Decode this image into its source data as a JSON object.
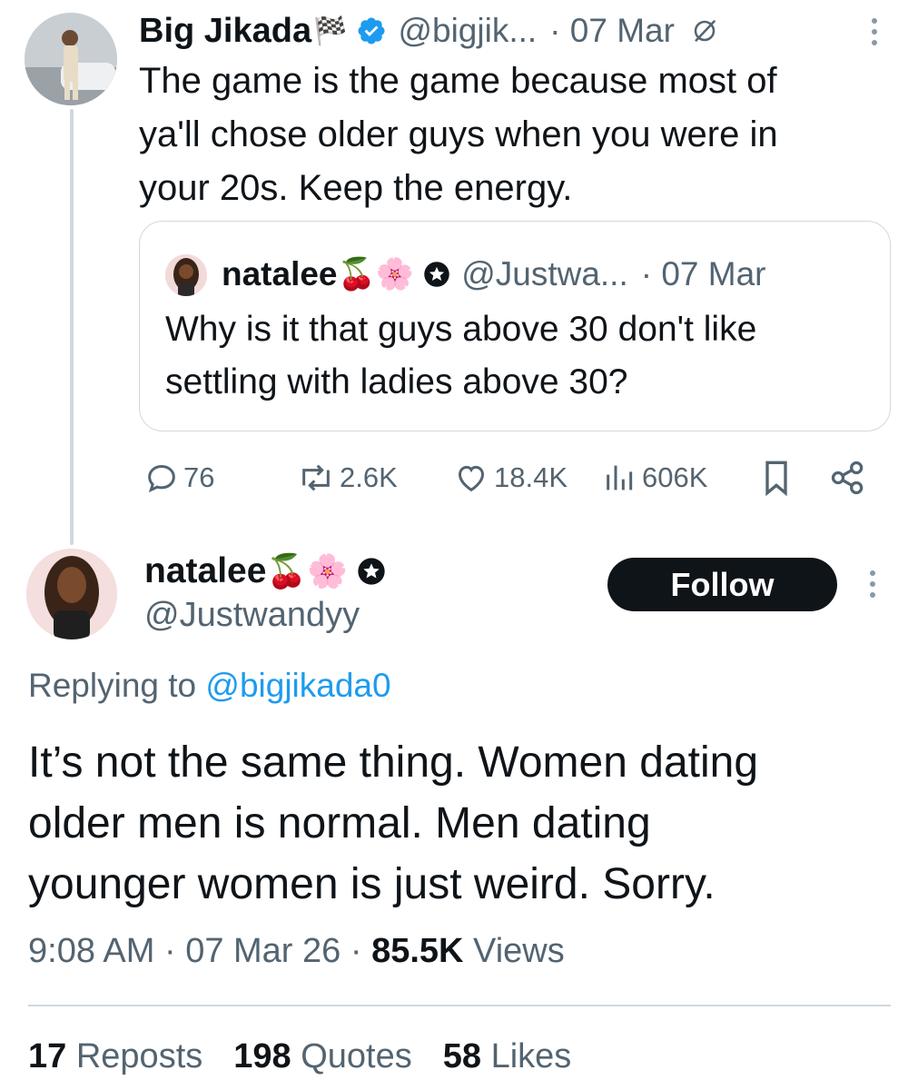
{
  "tweet1": {
    "author_name": "Big Jikada",
    "flag_emoji": "🏁",
    "handle": "@bigjik...",
    "date": "· 07 Mar",
    "text_lines": [
      "The game is the game because most of",
      "ya'll chose older guys when you were in",
      "your 20s. Keep the energy."
    ]
  },
  "quote": {
    "author_name": "natalee",
    "emojis": "🍒🌸",
    "handle": "@Justwa...",
    "date": "· 07 Mar",
    "text_lines": [
      "Why is it that guys above 30 don't like",
      "settling with ladies above 30?"
    ]
  },
  "actions": {
    "replies": "76",
    "reposts": "2.6K",
    "likes": "18.4K",
    "views": "606K"
  },
  "reply": {
    "author_name": "natalee",
    "emojis": "🍒🌸",
    "handle": "@Justwandyy",
    "follow_label": "Follow",
    "replying_prefix": "Replying to",
    "replying_to": "@bigjikada0",
    "text_lines": [
      "It’s not the same thing. Women dating",
      "older men is normal. Men dating",
      "younger women is just weird. Sorry."
    ],
    "time": "9:08 AM · 07 Mar 26 ·",
    "views_count": "85.5K",
    "views_label": "Views"
  },
  "stats": {
    "reposts_count": "17",
    "reposts_label": "Reposts",
    "quotes_count": "198",
    "quotes_label": "Quotes",
    "likes_count": "58",
    "likes_label": "Likes"
  },
  "colors": {
    "verified_blue": "#1d9bf0",
    "text": "#0f1419",
    "muted": "#536471",
    "link": "#1d9bf0"
  }
}
